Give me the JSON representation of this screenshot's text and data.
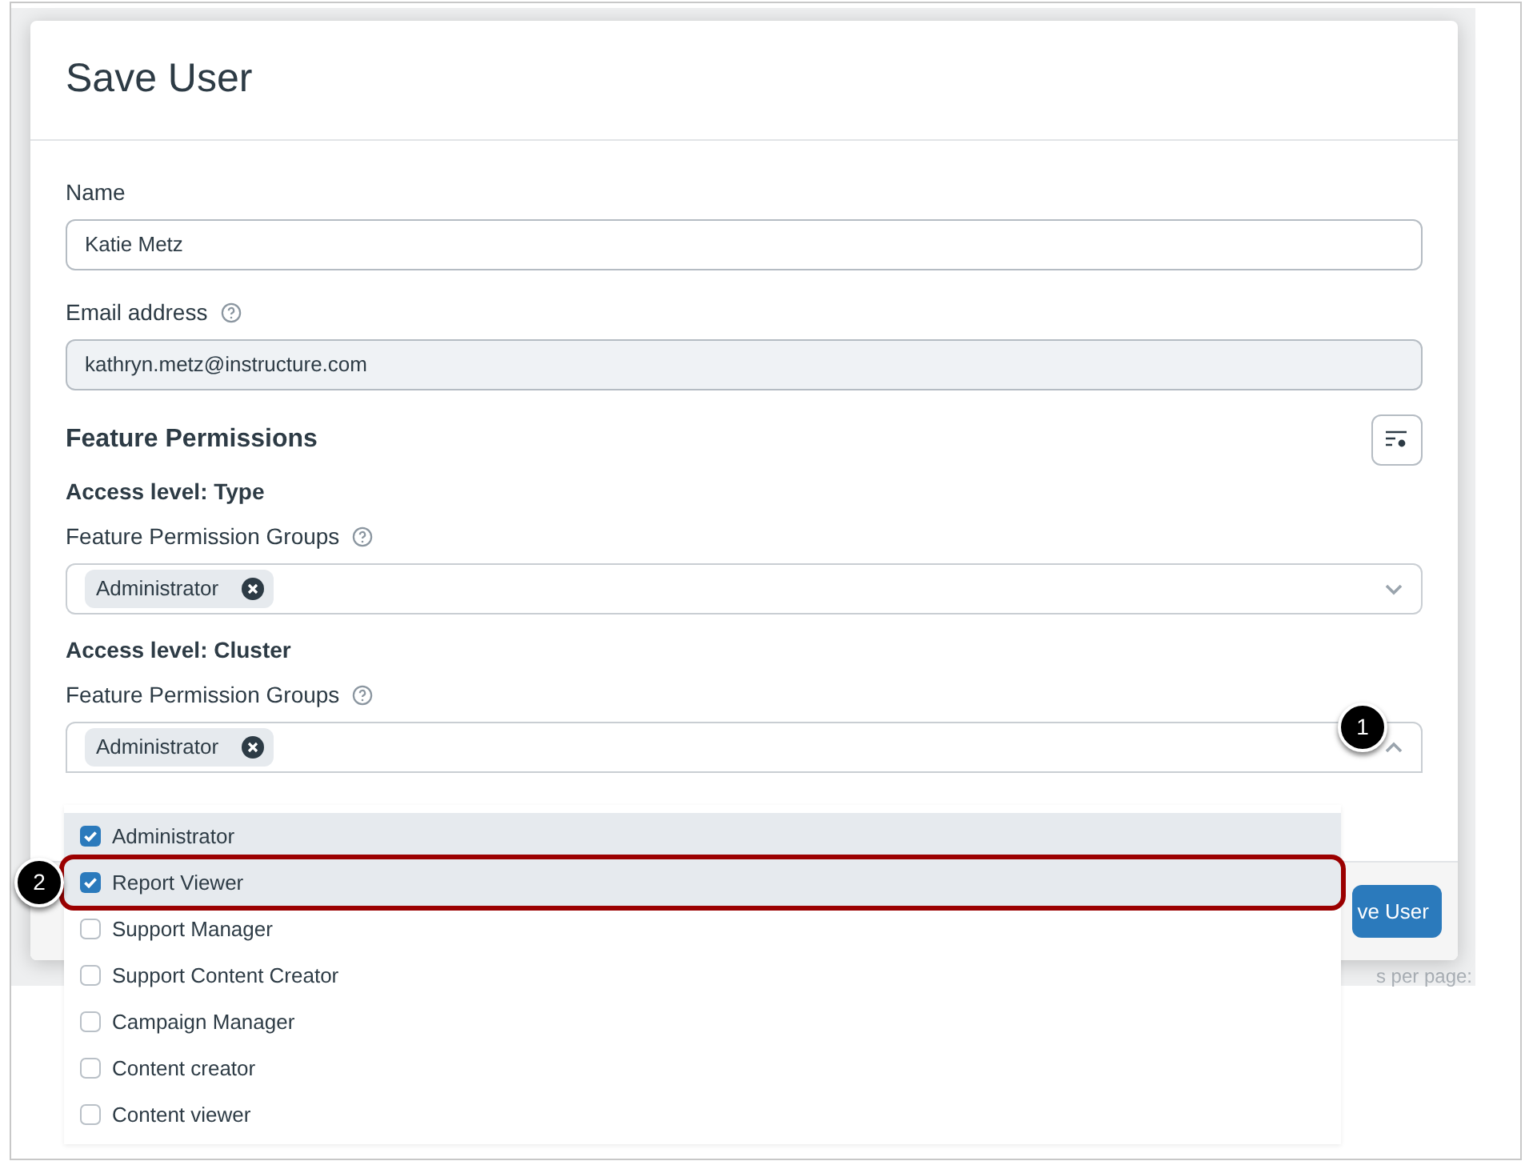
{
  "dialog": {
    "title": "Save User",
    "fields": [
      {
        "label": "Name",
        "value": "Katie Metz",
        "help": false,
        "filled": false
      },
      {
        "label": "Email address",
        "value": "kathryn.metz@instructure.com",
        "help": true,
        "filled": true
      }
    ],
    "section_title": "Feature Permissions",
    "access_levels": [
      {
        "title": "Access level: Type",
        "label": "Feature Permission Groups",
        "tags": [
          "Administrator"
        ],
        "expanded": false
      },
      {
        "title": "Access level: Cluster",
        "label": "Feature Permission Groups",
        "tags": [
          "Administrator"
        ],
        "expanded": true
      }
    ],
    "footer_button": "ve User"
  },
  "dropdown": {
    "options": [
      {
        "label": "Administrator",
        "checked": true,
        "highlighted": false
      },
      {
        "label": "Report Viewer",
        "checked": true,
        "highlighted": true
      },
      {
        "label": "Support Manager",
        "checked": false,
        "highlighted": false
      },
      {
        "label": "Support Content Creator",
        "checked": false,
        "highlighted": false
      },
      {
        "label": "Campaign Manager",
        "checked": false,
        "highlighted": false
      },
      {
        "label": "Content creator",
        "checked": false,
        "highlighted": false
      },
      {
        "label": "Content viewer",
        "checked": false,
        "highlighted": false
      }
    ]
  },
  "background_text": "s per page:",
  "callouts": [
    {
      "label": "1",
      "kind": "top"
    },
    {
      "label": "2",
      "kind": "left"
    }
  ]
}
